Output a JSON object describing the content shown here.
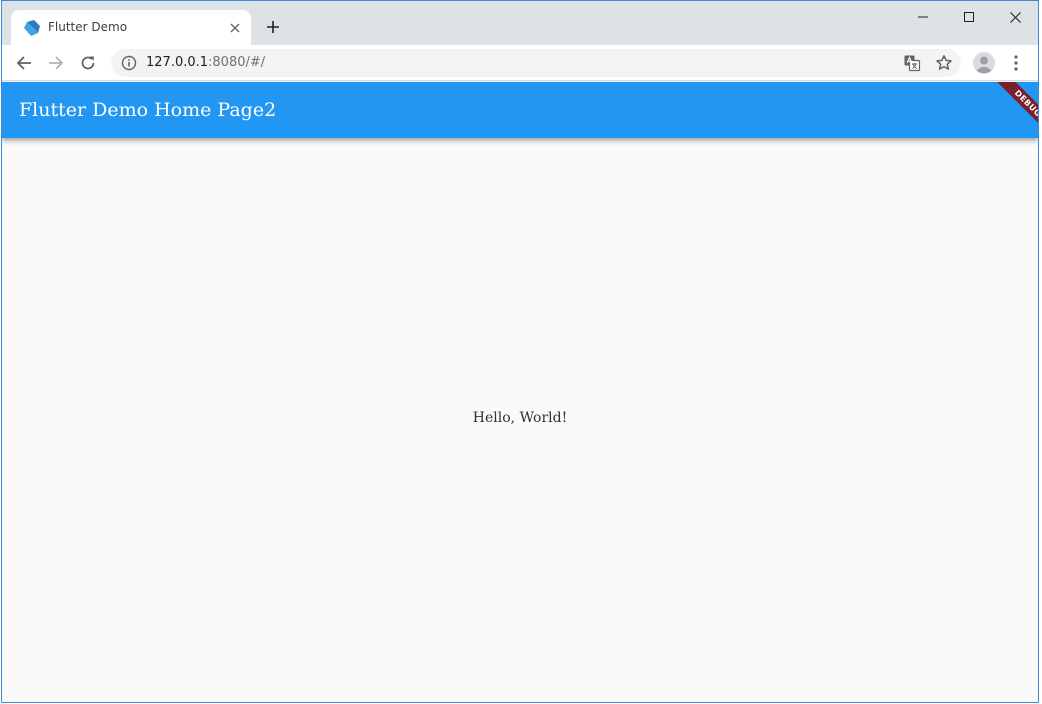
{
  "browser": {
    "tab": {
      "title": "Flutter Demo"
    },
    "address_bar": {
      "host": "127.0.0.1",
      "rest": ":8080/#/"
    }
  },
  "app": {
    "title": "Flutter Demo Home Page2",
    "debug_banner": "DEBUG",
    "body_text": "Hello, World!"
  },
  "icons": {
    "favicon": "dart-flutter-logo-icon",
    "tab_close": "close-icon",
    "new_tab": "plus-icon",
    "minimize": "minimize-icon",
    "maximize": "maximize-icon",
    "close_window": "close-icon",
    "back": "arrow-left-icon",
    "forward": "arrow-right-icon",
    "reload": "reload-icon",
    "site_info": "info-icon",
    "translate": "translate-icon",
    "bookmark": "star-icon",
    "profile": "avatar-icon",
    "menu": "kebab-menu-icon"
  },
  "colors": {
    "app_bar": "#2196f3",
    "debug_banner": "#7a1f2b",
    "background": "#fafafa",
    "tab_strip": "#dee1e6"
  }
}
